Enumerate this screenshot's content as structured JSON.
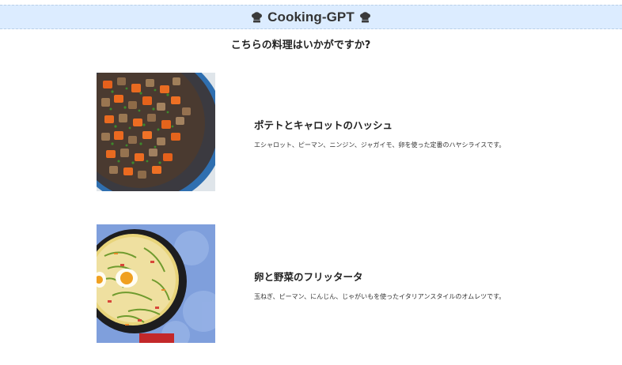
{
  "header": {
    "title": "Cooking-GPT",
    "left_icon": "chef-hat-icon",
    "right_icon": "chef-hat-icon",
    "background_color": "#dcecff"
  },
  "prompt": "こちらの料理はいかがですか?",
  "recipes": [
    {
      "name": "ポテトとキャロットのハッシュ",
      "description": "エシャロット、ピーマン、ニンジン、ジャガイモ、卵を使った定番のハヤシライスです。",
      "image": "potato-carrot-hash-photo"
    },
    {
      "name": "卵と野菜のフリッタータ",
      "description": "玉ねぎ、ピーマン、にんじん、じゃがいもを使ったイタリアンスタイルのオムレツです。",
      "image": "egg-vegetable-frittata-photo"
    }
  ]
}
